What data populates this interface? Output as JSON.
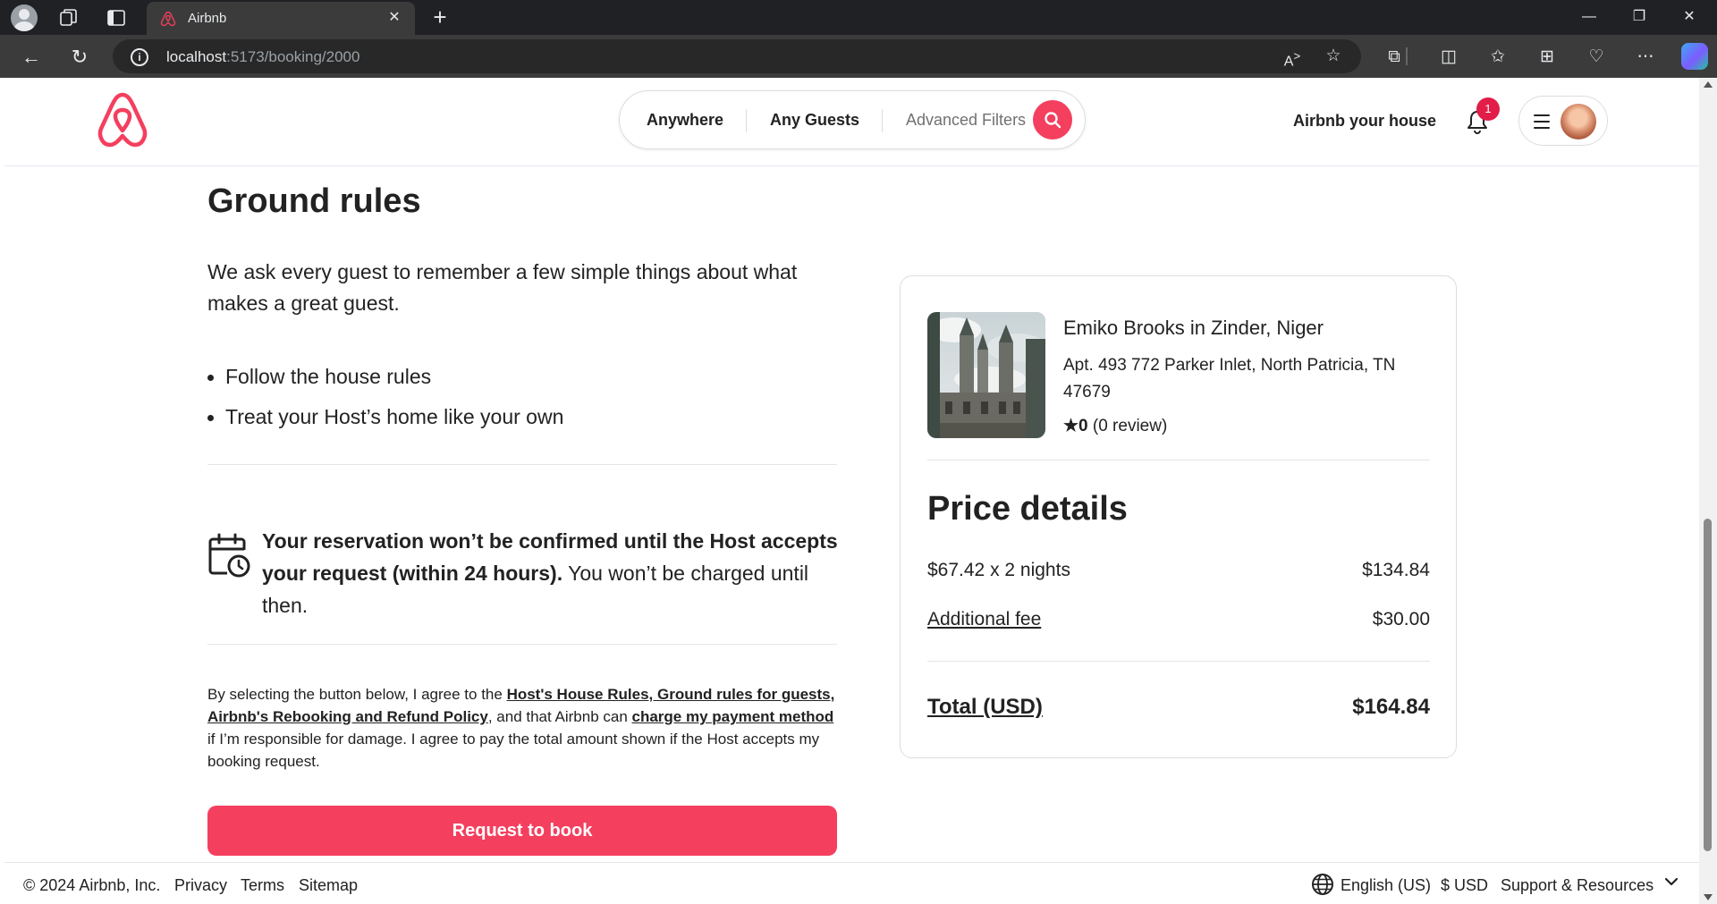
{
  "browser": {
    "tab_title": "Airbnb",
    "url_host": "localhost",
    "url_path": ":5173/booking/2000",
    "icons": [
      "profile-icon",
      "workspaces-icon",
      "tab-actions-icon",
      "back-icon",
      "refresh-icon",
      "info-icon",
      "read-aloud-icon",
      "favorite-icon",
      "extensions-icon",
      "split-screen-icon",
      "favorites-icon",
      "collections-icon",
      "health-icon",
      "more-icon",
      "copilot-icon"
    ]
  },
  "header": {
    "search": {
      "anywhere": "Anywhere",
      "guests": "Any Guests",
      "filters": "Advanced Filters"
    },
    "host_link": "Airbnb your house",
    "notification_count": "1",
    "brand_color": "#f43f5e"
  },
  "ground_rules": {
    "title": "Ground rules",
    "intro": "We ask every guest to remember a few simple things about what makes a great guest.",
    "items": [
      "Follow the house rules",
      "Treat your Host’s home like your own"
    ]
  },
  "reservation_note": {
    "bold": "Your reservation won’t be confirmed until the Host accepts your request (within 24 hours).",
    "rest": " You won’t be charged until then."
  },
  "legal": {
    "p1": "By selecting the button below, I agree to the ",
    "link1": "Host's House Rules, Ground rules for guests, Airbnb's Rebooking and Refund Policy",
    "p2": ", and that Airbnb can ",
    "link2": "charge my payment method",
    "p3": " if I’m responsible for damage. I agree to pay the total amount shown if the Host accepts my booking request."
  },
  "book_button": "Request to book",
  "listing": {
    "title": "Emiko Brooks in Zinder, Niger",
    "address": "Apt. 493 772 Parker Inlet, North Patricia, TN 47679",
    "rating_value": "★0",
    "rating_reviews": " (0 review)"
  },
  "price": {
    "title": "Price details",
    "nights_label": "$67.42 x 2 nights",
    "nights_value": "$134.84",
    "fee_label": "Additional fee",
    "fee_value": "$30.00",
    "total_label": "Total (USD)",
    "total_value": "$164.84"
  },
  "footer": {
    "copyright": "© 2024 Airbnb, Inc.",
    "privacy": "Privacy",
    "terms": "Terms",
    "sitemap": "Sitemap",
    "language": "English (US)",
    "currency": "$ USD",
    "support": "Support & Resources"
  }
}
